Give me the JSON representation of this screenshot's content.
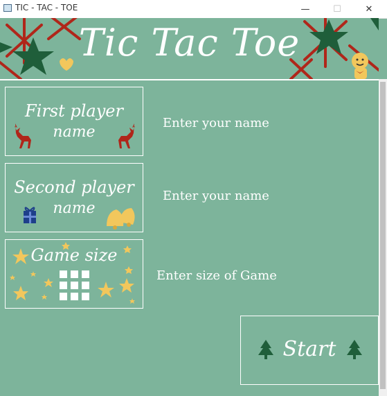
{
  "window": {
    "title": "TIC - TAC - TOE"
  },
  "banner": {
    "title": "Tic Tac Toe"
  },
  "first_player": {
    "label_line1": "First player",
    "label_line2": "name",
    "placeholder": "Enter your name"
  },
  "second_player": {
    "label_line1": "Second player",
    "label_line2": "name",
    "placeholder": "Enter your name"
  },
  "game_size": {
    "label": "Game size",
    "placeholder": "Enter size of Game"
  },
  "start": {
    "label": "Start"
  },
  "colors": {
    "background": "#7db49b",
    "text": "#ffffff",
    "red": "#b0261a",
    "gold": "#f2c75c",
    "green": "#1f5e3a",
    "blue": "#1e3f8a"
  }
}
